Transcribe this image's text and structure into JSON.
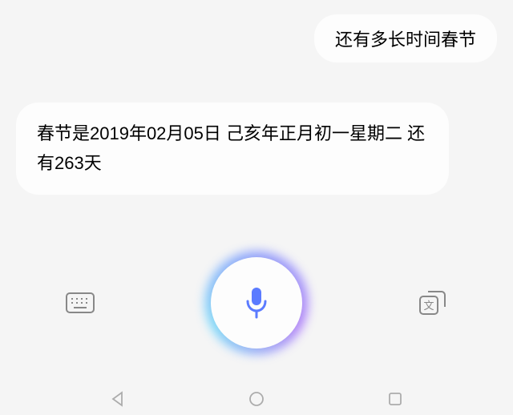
{
  "chat": {
    "user_message": "还有多长时间春节",
    "assistant_reply": "春节是2019年02月05日 己亥年正月初一星期二 还有263天"
  },
  "controls": {
    "keyboard_label": "keyboard",
    "mic_label": "voice-input",
    "translate_label": "translate"
  },
  "colors": {
    "bubble_bg": "#fdfdfd",
    "page_bg": "#f5f5f5",
    "mic_accent": "#5b7bff"
  }
}
